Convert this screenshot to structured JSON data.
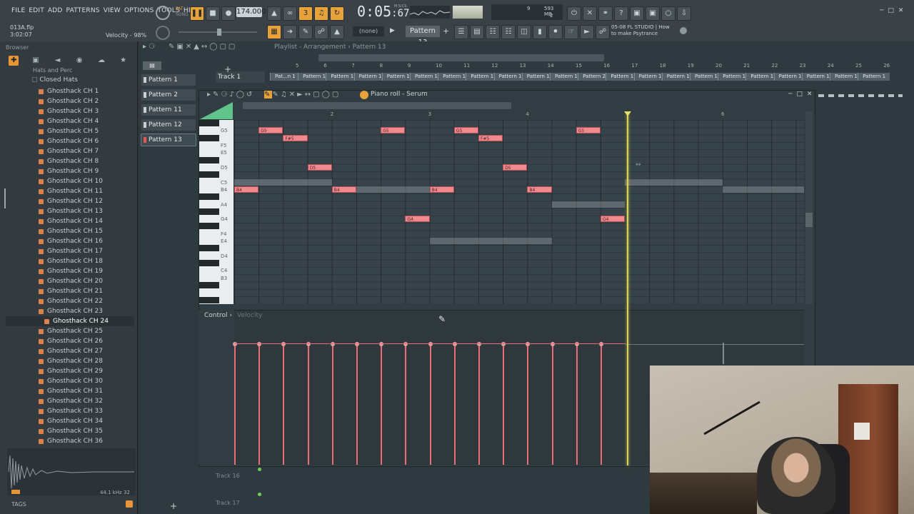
{
  "menu": [
    "FILE",
    "EDIT",
    "ADD",
    "PATTERNS",
    "VIEW",
    "OPTIONS",
    "TOOLS",
    "HELP"
  ],
  "transport": {
    "pat_label": "PAT",
    "song_label": "SONG",
    "tempo": "174.000",
    "time": "0:05",
    "time_sub": ":67",
    "time_unit": "M:S:CS"
  },
  "hint": {
    "file": "013A.flp",
    "time": "3:02:07",
    "velocity": "Velocity - 98%"
  },
  "perf": {
    "cpu": "9",
    "mem": "593 MB",
    "poly": "2"
  },
  "pattern_select": "Pattern 13",
  "none_select": "(none)",
  "news": {
    "line1": "05-08  FL STUDIO | How",
    "line2": "to make Psytrance"
  },
  "browser": {
    "title": "Browser",
    "folder_partial": "Hats and Perc",
    "folder": "Closed Hats",
    "files": [
      "Ghosthack CH 1",
      "Ghosthack CH 2",
      "Ghosthack CH 3",
      "Ghosthack CH 4",
      "Ghosthack CH 5",
      "Ghosthack CH 6",
      "Ghosthack CH 7",
      "Ghosthack CH 8",
      "Ghosthack CH 9",
      "Ghosthack CH 10",
      "Ghosthack CH 11",
      "Ghosthack CH 12",
      "Ghosthack CH 13",
      "Ghosthack CH 14",
      "Ghosthack CH 15",
      "Ghosthack CH 16",
      "Ghosthack CH 17",
      "Ghosthack CH 18",
      "Ghosthack CH 19",
      "Ghosthack CH 20",
      "Ghosthack CH 21",
      "Ghosthack CH 22",
      "Ghosthack CH 23",
      "Ghosthack CH 24",
      "Ghosthack CH 25",
      "Ghosthack CH 26",
      "Ghosthack CH 27",
      "Ghosthack CH 28",
      "Ghosthack CH 29",
      "Ghosthack CH 30",
      "Ghosthack CH 31",
      "Ghosthack CH 32",
      "Ghosthack CH 33",
      "Ghosthack CH 34",
      "Ghosthack CH 35",
      "Ghosthack CH 36"
    ],
    "selected_index": 23,
    "tags": "TAGS",
    "rate": "44.1 kHz 32"
  },
  "playlist": {
    "title": "Playlist - Arrangement › Pattern 13",
    "patterns": [
      "Pattern 1",
      "Pattern 2",
      "Pattern 11",
      "Pattern 12",
      "Pattern 13"
    ],
    "selected_pattern": 4,
    "track1": "Track 1",
    "track16": "Track 16",
    "track17": "Track 17",
    "ruler": [
      "5",
      "6",
      "7",
      "8",
      "9",
      "10",
      "11",
      "12",
      "13",
      "14",
      "15",
      "16",
      "17",
      "18",
      "19",
      "20",
      "21",
      "22",
      "23",
      "24",
      "25",
      "26"
    ],
    "clips": [
      "Pat...n 1",
      "Pattern 1",
      "Pattern 1",
      "Pattern 1",
      "Pattern 1",
      "Pattern 1",
      "Pattern 1",
      "Pattern 1",
      "Pattern 1",
      "Pattern 1",
      "Pattern 1",
      "Pattern 2",
      "Pattern 1",
      "Pattern 1",
      "Pattern 1",
      "Pattern 1",
      "Pattern 1",
      "Pattern 1",
      "Pattern 1",
      "Pattern 1",
      "Pattern 1",
      "Pattern 1"
    ]
  },
  "piano_roll": {
    "title": "Piano roll - Serum",
    "ruler": [
      "2",
      "3",
      "4",
      "6"
    ],
    "key_labels": [
      "G5",
      "F5",
      "E5",
      "D5",
      "C5",
      "B4",
      "A4",
      "G4",
      "F4",
      "E4",
      "D4",
      "C4",
      "B3"
    ],
    "notes": [
      {
        "label": "B4",
        "row": "B4",
        "start": 0,
        "len": 1
      },
      {
        "label": "G5",
        "row": "G5",
        "start": 1,
        "len": 1
      },
      {
        "label": "F#5",
        "row": "F#5",
        "start": 2,
        "len": 1
      },
      {
        "label": "D5",
        "row": "D5",
        "start": 3,
        "len": 1
      },
      {
        "label": "B4",
        "row": "B4",
        "start": 4,
        "len": 1
      },
      {
        "label": "G5",
        "row": "G5",
        "start": 6,
        "len": 1
      },
      {
        "label": "G4",
        "row": "G4",
        "start": 7,
        "len": 1
      },
      {
        "label": "B4",
        "row": "B4",
        "start": 8,
        "len": 1
      },
      {
        "label": "G5",
        "row": "G5",
        "start": 9,
        "len": 1
      },
      {
        "label": "F#5",
        "row": "F#5",
        "start": 10,
        "len": 1
      },
      {
        "label": "D5",
        "row": "D5",
        "start": 11,
        "len": 1
      },
      {
        "label": "B4",
        "row": "B4",
        "start": 12,
        "len": 1
      },
      {
        "label": "G5",
        "row": "G5",
        "start": 14,
        "len": 1
      },
      {
        "label": "G4",
        "row": "G4",
        "start": 15,
        "len": 1
      }
    ],
    "ghost_notes": [
      {
        "row": "C5",
        "start": 0,
        "len": 4
      },
      {
        "row": "B4",
        "start": 5,
        "len": 3
      },
      {
        "row": "E4",
        "start": 8,
        "len": 5
      },
      {
        "row": "A4",
        "start": 13,
        "len": 3
      },
      {
        "row": "C5",
        "start": 16,
        "len": 4
      },
      {
        "row": "B4",
        "start": 20,
        "len": 4
      }
    ],
    "control_label": "Control",
    "velocity_label": "Velocity",
    "velocity_steps": 16,
    "velocity_value": 0.98
  }
}
